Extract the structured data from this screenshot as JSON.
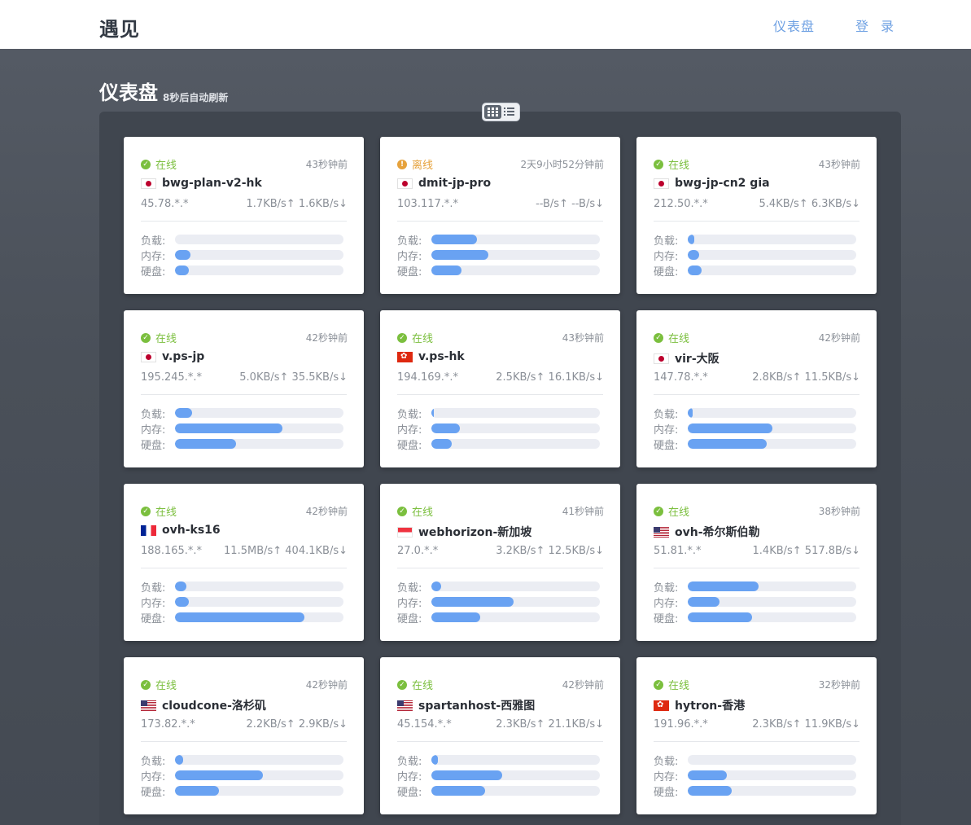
{
  "header": {
    "brand": "遇见",
    "nav": {
      "dashboard": "仪表盘",
      "login": "登 录"
    }
  },
  "page": {
    "title": "仪表盘",
    "refresh_note": "8秒后自动刷新",
    "view_modes": [
      "grid-icon",
      "list-icon"
    ],
    "active_view": "grid"
  },
  "colors": {
    "online": "#7bbf3e",
    "offline": "#e6a23c",
    "bar_fill": "#69a2f2",
    "bar_track": "#ebedf3",
    "link": "#6fa1e3"
  },
  "labels": {
    "load": "负载:",
    "memory": "内存:",
    "disk": "硬盘:"
  },
  "servers": [
    {
      "status": "online",
      "status_text": "在线",
      "last_seen": "43秒钟前",
      "flag": "jp",
      "name": "bwg-plan-v2-hk",
      "ip": "45.78.*.*",
      "net": "1.7KB/s↑ 1.6KB/s↓",
      "load": 0,
      "memory": 0.09,
      "disk": 0.08
    },
    {
      "status": "offline",
      "status_text": "离线",
      "last_seen": "2天9小时52分钟前",
      "flag": "jp",
      "name": "dmit-jp-pro",
      "ip": "103.117.*.*",
      "net": "--B/s↑ --B/s↓",
      "load": 0.27,
      "memory": 0.34,
      "disk": 0.18
    },
    {
      "status": "online",
      "status_text": "在线",
      "last_seen": "43秒钟前",
      "flag": "jp",
      "name": "bwg-jp-cn2 gia",
      "ip": "212.50.*.*",
      "net": "5.4KB/s↑ 6.3KB/s↓",
      "load": 0.04,
      "memory": 0.07,
      "disk": 0.08
    },
    {
      "status": "online",
      "status_text": "在线",
      "last_seen": "42秒钟前",
      "flag": "jp",
      "name": "v.ps-jp",
      "ip": "195.245.*.*",
      "net": "5.0KB/s↑ 35.5KB/s↓",
      "load": 0.1,
      "memory": 0.64,
      "disk": 0.36
    },
    {
      "status": "online",
      "status_text": "在线",
      "last_seen": "43秒钟前",
      "flag": "hk",
      "name": "v.ps-hk",
      "ip": "194.169.*.*",
      "net": "2.5KB/s↑ 16.1KB/s↓",
      "load": 0.01,
      "memory": 0.17,
      "disk": 0.12
    },
    {
      "status": "online",
      "status_text": "在线",
      "last_seen": "42秒钟前",
      "flag": "jp",
      "name": "vir-大阪",
      "ip": "147.78.*.*",
      "net": "2.8KB/s↑ 11.5KB/s↓",
      "load": 0.03,
      "memory": 0.5,
      "disk": 0.47
    },
    {
      "status": "online",
      "status_text": "在线",
      "last_seen": "42秒钟前",
      "flag": "fr",
      "name": "ovh-ks16",
      "ip": "188.165.*.*",
      "net": "11.5MB/s↑ 404.1KB/s↓",
      "load": 0.07,
      "memory": 0.08,
      "disk": 0.77
    },
    {
      "status": "online",
      "status_text": "在线",
      "last_seen": "41秒钟前",
      "flag": "sg",
      "name": "webhorizon-新加坡",
      "ip": "27.0.*.*",
      "net": "3.2KB/s↑ 12.5KB/s↓",
      "load": 0.06,
      "memory": 0.49,
      "disk": 0.29
    },
    {
      "status": "online",
      "status_text": "在线",
      "last_seen": "38秒钟前",
      "flag": "us",
      "name": "ovh-希尔斯伯勒",
      "ip": "51.81.*.*",
      "net": "1.4KB/s↑ 517.8B/s↓",
      "load": 0.42,
      "memory": 0.19,
      "disk": 0.38
    },
    {
      "status": "online",
      "status_text": "在线",
      "last_seen": "42秒钟前",
      "flag": "us",
      "name": "cloudcone-洛杉矶",
      "ip": "173.82.*.*",
      "net": "2.2KB/s↑ 2.9KB/s↓",
      "load": 0.05,
      "memory": 0.52,
      "disk": 0.26
    },
    {
      "status": "online",
      "status_text": "在线",
      "last_seen": "42秒钟前",
      "flag": "us",
      "name": "spartanhost-西雅图",
      "ip": "45.154.*.*",
      "net": "2.3KB/s↑ 21.1KB/s↓",
      "load": 0.04,
      "memory": 0.42,
      "disk": 0.32
    },
    {
      "status": "online",
      "status_text": "在线",
      "last_seen": "32秒钟前",
      "flag": "hk",
      "name": "hytron-香港",
      "ip": "191.96.*.*",
      "net": "2.3KB/s↑ 11.9KB/s↓",
      "load": 0,
      "memory": 0.23,
      "disk": 0.26
    }
  ]
}
